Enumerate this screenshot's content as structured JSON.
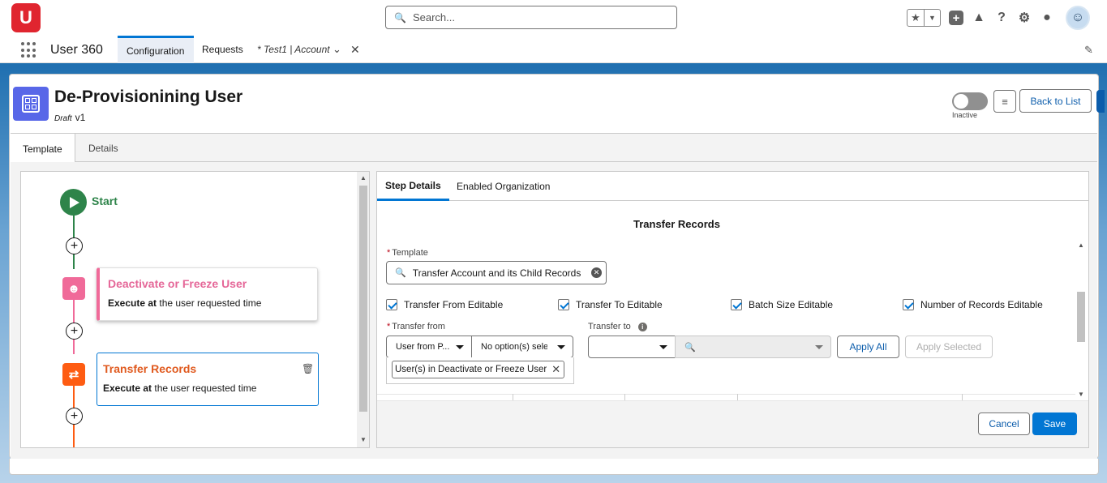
{
  "header": {
    "logo_text": "U",
    "search_placeholder": "Search...",
    "icons": [
      "favorites-star-icon",
      "favorites-menu-icon",
      "global-add-icon",
      "trailhead-icon",
      "help-icon",
      "setup-gear-icon",
      "notifications-bell-icon",
      "user-avatar"
    ]
  },
  "nav": {
    "app_name": "User 360",
    "tabs": [
      {
        "label": "Configuration",
        "active": true
      },
      {
        "label": "Requests",
        "active": false
      },
      {
        "label": "* Test1 | Account",
        "active": false
      }
    ]
  },
  "record": {
    "title": "De-Provisionining User",
    "status": "Draft",
    "version": "v1",
    "toggle_label": "Inactive",
    "toggle_on": false,
    "back_button": "Back to List"
  },
  "main_tabs": [
    {
      "label": "Template",
      "active": true
    },
    {
      "label": "Details",
      "active": false
    }
  ],
  "flow": {
    "start_label": "Start",
    "steps": [
      {
        "title": "Deactivate or Freeze User",
        "desc_bold": "Execute at",
        "desc_rest": " the user requested time",
        "color": "#f06a99"
      },
      {
        "title": "Transfer Records",
        "desc_bold": "Execute at",
        "desc_rest": " the user requested time",
        "color": "#fe5c12"
      }
    ]
  },
  "step_details": {
    "tabs": [
      {
        "label": "Step Details",
        "active": true
      },
      {
        "label": "Enabled Organization",
        "active": false
      }
    ],
    "section_title": "Transfer Records",
    "template_label": "Template",
    "template_value": "Transfer Account and its Child Records",
    "checkboxes": [
      {
        "label": "Transfer From Editable",
        "checked": true
      },
      {
        "label": "Transfer To Editable",
        "checked": true
      },
      {
        "label": "Batch Size Editable",
        "checked": true
      },
      {
        "label": "Number of Records Editable",
        "checked": true
      }
    ],
    "transfer_from_label": "Transfer from",
    "transfer_from_type": "User from P...",
    "transfer_from_options": "No option(s) selected",
    "transfer_to_label": "Transfer to",
    "selected_pill": "User(s) in Deactivate or Freeze User",
    "apply_all": "Apply All",
    "apply_selected": "Apply Selected",
    "cancel": "Cancel",
    "save": "Save"
  },
  "colors": {
    "brand": "#0176d3",
    "start_green": "#2e844a",
    "deactivate_pink": "#f06a99",
    "transfer_orange": "#fe5c12"
  }
}
